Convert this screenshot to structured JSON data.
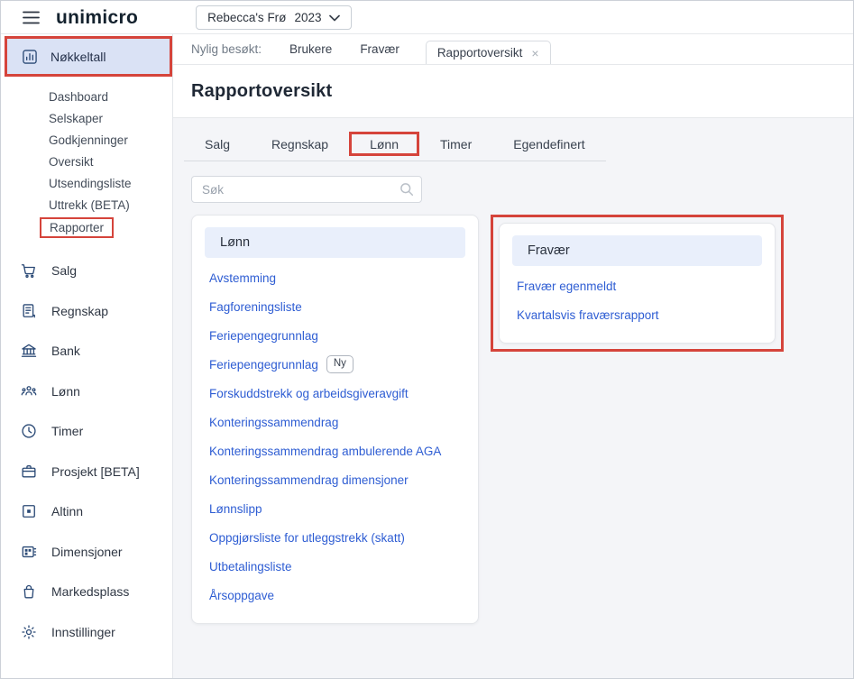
{
  "topbar": {
    "logo_text": "unimicro",
    "company_selector": {
      "company": "Rebecca's Frø",
      "year": "2023"
    }
  },
  "sidebar": {
    "items": [
      {
        "label": "Nøkkeltall",
        "icon": "bar-chart-icon",
        "active": true,
        "annotated": true
      },
      {
        "label": "Salg",
        "icon": "cart-icon"
      },
      {
        "label": "Regnskap",
        "icon": "ledger-icon"
      },
      {
        "label": "Bank",
        "icon": "bank-icon"
      },
      {
        "label": "Lønn",
        "icon": "people-icon"
      },
      {
        "label": "Timer",
        "icon": "clock-icon"
      },
      {
        "label": "Prosjekt [BETA]",
        "icon": "briefcase-icon"
      },
      {
        "label": "Altinn",
        "icon": "altinn-icon"
      },
      {
        "label": "Dimensjoner",
        "icon": "grid-icon"
      },
      {
        "label": "Markedsplass",
        "icon": "shopping-bag-icon"
      },
      {
        "label": "Innstillinger",
        "icon": "gear-icon"
      }
    ],
    "sub_items": [
      {
        "label": "Dashboard"
      },
      {
        "label": "Selskaper"
      },
      {
        "label": "Godkjenninger"
      },
      {
        "label": "Oversikt"
      },
      {
        "label": "Utsendingsliste"
      },
      {
        "label": "Uttrekk (BETA)"
      },
      {
        "label": "Rapporter",
        "annotated": true
      }
    ]
  },
  "recent_bar": {
    "label": "Nylig besøkt:",
    "links": [
      "Brukere",
      "Fravær"
    ],
    "open_tab": {
      "label": "Rapportoversikt",
      "close": "×"
    }
  },
  "page": {
    "title": "Rapportoversikt",
    "tabs": [
      "Salg",
      "Regnskap",
      "Lønn",
      "Timer",
      "Egendefinert"
    ],
    "annotated_tab": "Lønn",
    "search": {
      "placeholder": "Søk"
    }
  },
  "cards": [
    {
      "header": "Lønn",
      "items": [
        {
          "label": "Avstemming"
        },
        {
          "label": "Fagforeningsliste"
        },
        {
          "label": "Feriepengegrunnlag"
        },
        {
          "label": "Feriepengegrunnlag",
          "badge": "Ny"
        },
        {
          "label": "Forskuddstrekk og arbeidsgiveravgift"
        },
        {
          "label": "Konteringssammendrag"
        },
        {
          "label": "Konteringssammendrag ambulerende AGA"
        },
        {
          "label": "Konteringssammendrag dimensjoner"
        },
        {
          "label": "Lønnslipp"
        },
        {
          "label": "Oppgjørsliste for utleggstrekk (skatt)"
        },
        {
          "label": "Utbetalingsliste"
        },
        {
          "label": "Årsoppgave"
        }
      ]
    },
    {
      "header": "Fravær",
      "annotated": true,
      "items": [
        {
          "label": "Fravær egenmeldt"
        },
        {
          "label": "Kvartalsvis fraværsrapport"
        }
      ]
    }
  ],
  "colors": {
    "annotation_red": "#d5443b",
    "link_blue": "#2e5dd3",
    "active_item_bg": "#dae2f5",
    "card_header_bg": "#e9effb",
    "icon_navy": "#2b4a76"
  }
}
